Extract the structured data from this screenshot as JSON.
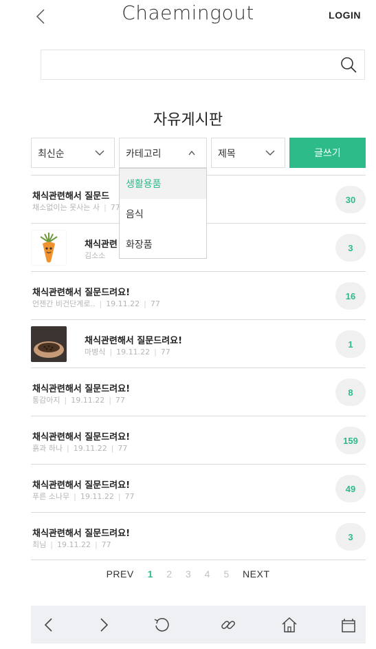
{
  "header": {
    "brand": "Chaemingout",
    "login_label": "LOGIN"
  },
  "search": {
    "placeholder": "",
    "value": ""
  },
  "board": {
    "title": "자유게시판"
  },
  "filters": {
    "sort_label": "최신순",
    "category_label": "카테고리",
    "field_label": "제목",
    "write_label": "글쓰기"
  },
  "category_dropdown": {
    "options": [
      "생활용품",
      "음식",
      "화장품"
    ],
    "selected_index": 0
  },
  "posts": [
    {
      "title": "채식관련해서 질문드",
      "author": "채소없이는 못사는 사",
      "date": "",
      "views": "77",
      "comments": "30",
      "thumb": null
    },
    {
      "title": "채식관련",
      "author": "김소소",
      "date": "",
      "views": "",
      "comments": "3",
      "thumb": "carrot"
    },
    {
      "title": "채식관련해서 질문드려요!",
      "author": "언젠간 비건단계로..",
      "date": "19.11.22",
      "views": "77",
      "comments": "16",
      "thumb": null
    },
    {
      "title": "채식관련해서 질문드려요!",
      "author": "마병식",
      "date": "19.11.22",
      "views": "77",
      "comments": "1",
      "thumb": "seeds"
    },
    {
      "title": "채식관련해서 질문드려요!",
      "author": "통감아지",
      "date": "19.11.22",
      "views": "77",
      "comments": "8",
      "thumb": null
    },
    {
      "title": "채식관련해서 질문드려요!",
      "author": "흙과 하나",
      "date": "19.11.22",
      "views": "77",
      "comments": "159",
      "thumb": null
    },
    {
      "title": "채식관련해서 질문드려요!",
      "author": "푸른 소나무",
      "date": "19.11.22",
      "views": "77",
      "comments": "49",
      "thumb": null
    },
    {
      "title": "채식관련해서 질문드려요!",
      "author": "최님",
      "date": "19.11.22",
      "views": "77",
      "comments": "3",
      "thumb": null
    }
  ],
  "pagination": {
    "prev_label": "PREV",
    "next_label": "NEXT",
    "pages": [
      "1",
      "2",
      "3",
      "4",
      "5"
    ],
    "current": "1"
  },
  "bottom_bar": {
    "icons": [
      "back-arrow-icon",
      "forward-arrow-icon",
      "refresh-icon",
      "link-icon",
      "home-icon",
      "tabs-icon"
    ]
  },
  "colors": {
    "accent": "#2dbb8a",
    "badge_bg": "#f0f0f0",
    "bottom_bar_bg": "#eef0f3"
  }
}
